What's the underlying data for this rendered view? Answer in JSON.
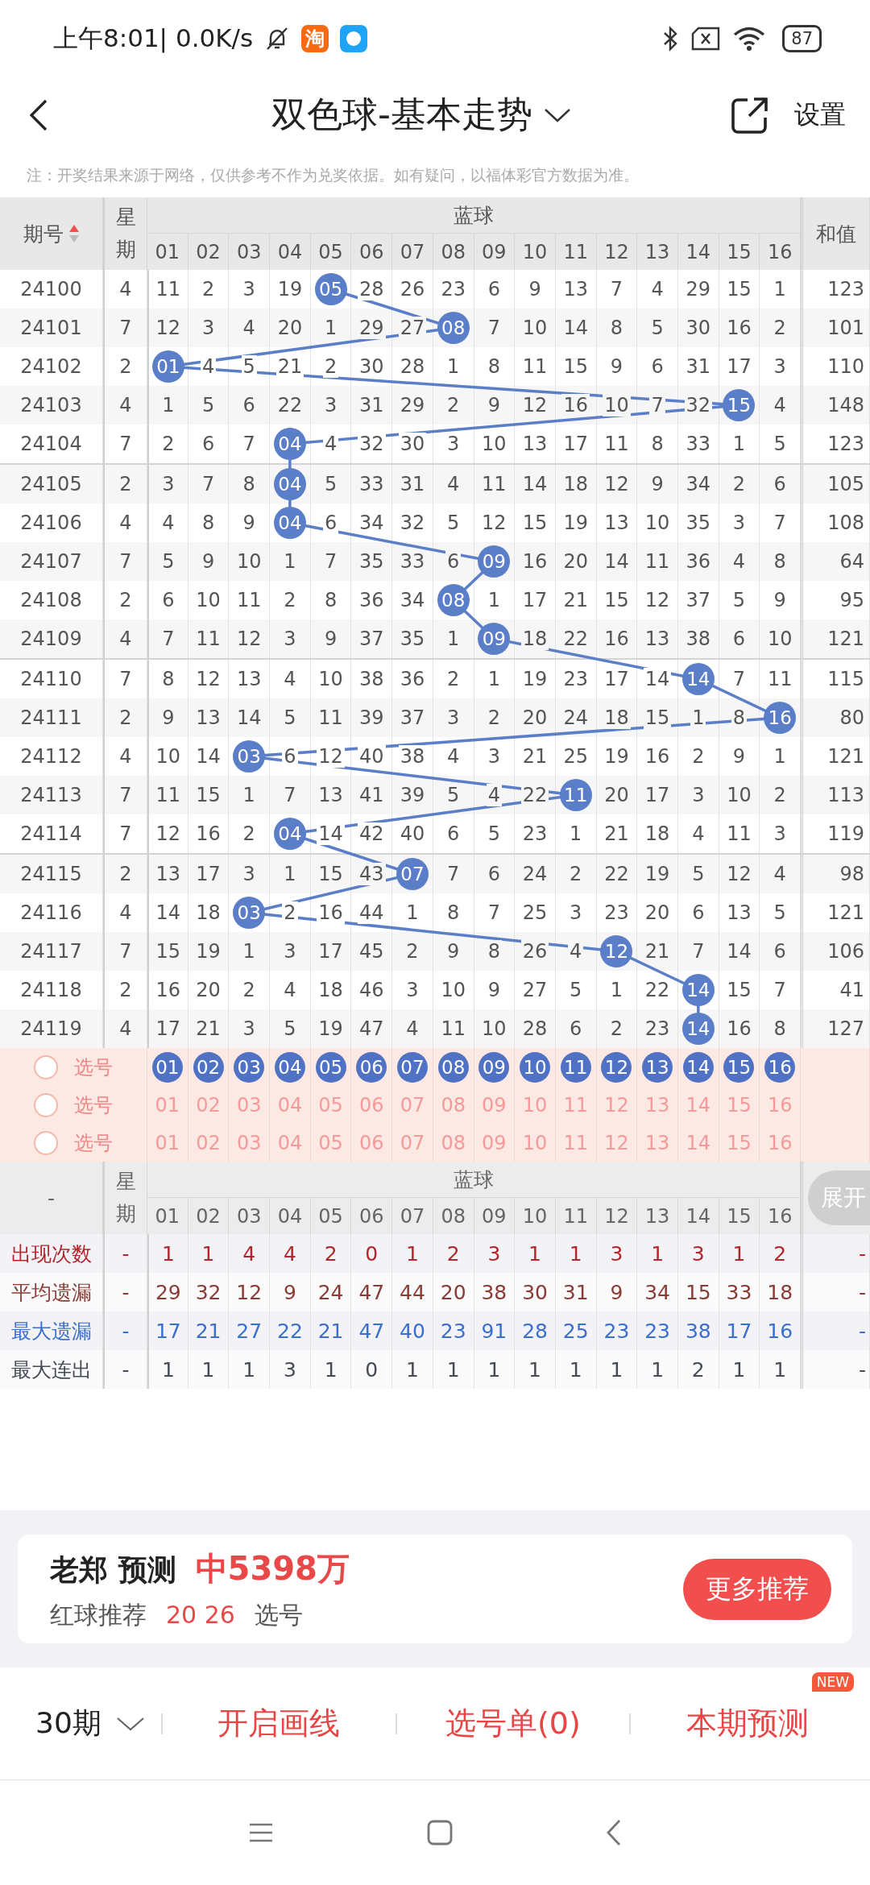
{
  "status_bar": {
    "time": "上午8:01| 0.0K/s",
    "app_glyph": "淘",
    "battery": "87"
  },
  "header": {
    "title": "双色球-基本走势",
    "settings": "设置"
  },
  "notice": "注：开奖结果来源于网络，仅供参考不作为兑奖依据。如有疑问，以福体彩官方数据为准。",
  "table": {
    "columns": {
      "period": "期号",
      "weekday": "星期",
      "group": "蓝球",
      "balls": [
        "01",
        "02",
        "03",
        "04",
        "05",
        "06",
        "07",
        "08",
        "09",
        "10",
        "11",
        "12",
        "13",
        "14",
        "15",
        "16"
      ],
      "sum": "和值"
    },
    "rows": [
      {
        "period": "24100",
        "weekday": "4",
        "sum": "123",
        "cells": [
          {
            "text": "11",
            "hit": false
          },
          {
            "text": "2",
            "hit": false
          },
          {
            "text": "3",
            "hit": false
          },
          {
            "text": "19",
            "hit": false
          },
          {
            "text": "05",
            "hit": true
          },
          {
            "text": "28",
            "hit": false
          },
          {
            "text": "26",
            "hit": false
          },
          {
            "text": "23",
            "hit": false
          },
          {
            "text": "6",
            "hit": false
          },
          {
            "text": "9",
            "hit": false
          },
          {
            "text": "13",
            "hit": false
          },
          {
            "text": "7",
            "hit": false
          },
          {
            "text": "4",
            "hit": false
          },
          {
            "text": "29",
            "hit": false
          },
          {
            "text": "15",
            "hit": false
          },
          {
            "text": "1",
            "hit": false
          }
        ]
      },
      {
        "period": "24101",
        "weekday": "7",
        "sum": "101",
        "cells": [
          {
            "text": "12",
            "hit": false
          },
          {
            "text": "3",
            "hit": false
          },
          {
            "text": "4",
            "hit": false
          },
          {
            "text": "20",
            "hit": false
          },
          {
            "text": "1",
            "hit": false
          },
          {
            "text": "29",
            "hit": false
          },
          {
            "text": "27",
            "hit": false
          },
          {
            "text": "08",
            "hit": true
          },
          {
            "text": "7",
            "hit": false
          },
          {
            "text": "10",
            "hit": false
          },
          {
            "text": "14",
            "hit": false
          },
          {
            "text": "8",
            "hit": false
          },
          {
            "text": "5",
            "hit": false
          },
          {
            "text": "30",
            "hit": false
          },
          {
            "text": "16",
            "hit": false
          },
          {
            "text": "2",
            "hit": false
          }
        ]
      },
      {
        "period": "24102",
        "weekday": "2",
        "sum": "110",
        "cells": [
          {
            "text": "01",
            "hit": true
          },
          {
            "text": "4",
            "hit": false
          },
          {
            "text": "5",
            "hit": false
          },
          {
            "text": "21",
            "hit": false
          },
          {
            "text": "2",
            "hit": false
          },
          {
            "text": "30",
            "hit": false
          },
          {
            "text": "28",
            "hit": false
          },
          {
            "text": "1",
            "hit": false
          },
          {
            "text": "8",
            "hit": false
          },
          {
            "text": "11",
            "hit": false
          },
          {
            "text": "15",
            "hit": false
          },
          {
            "text": "9",
            "hit": false
          },
          {
            "text": "6",
            "hit": false
          },
          {
            "text": "31",
            "hit": false
          },
          {
            "text": "17",
            "hit": false
          },
          {
            "text": "3",
            "hit": false
          }
        ]
      },
      {
        "period": "24103",
        "weekday": "4",
        "sum": "148",
        "cells": [
          {
            "text": "1",
            "hit": false
          },
          {
            "text": "5",
            "hit": false
          },
          {
            "text": "6",
            "hit": false
          },
          {
            "text": "22",
            "hit": false
          },
          {
            "text": "3",
            "hit": false
          },
          {
            "text": "31",
            "hit": false
          },
          {
            "text": "29",
            "hit": false
          },
          {
            "text": "2",
            "hit": false
          },
          {
            "text": "9",
            "hit": false
          },
          {
            "text": "12",
            "hit": false
          },
          {
            "text": "16",
            "hit": false
          },
          {
            "text": "10",
            "hit": false
          },
          {
            "text": "7",
            "hit": false
          },
          {
            "text": "32",
            "hit": false
          },
          {
            "text": "15",
            "hit": true
          },
          {
            "text": "4",
            "hit": false
          }
        ]
      },
      {
        "period": "24104",
        "weekday": "7",
        "sum": "123",
        "cells": [
          {
            "text": "2",
            "hit": false
          },
          {
            "text": "6",
            "hit": false
          },
          {
            "text": "7",
            "hit": false
          },
          {
            "text": "04",
            "hit": true
          },
          {
            "text": "4",
            "hit": false
          },
          {
            "text": "32",
            "hit": false
          },
          {
            "text": "30",
            "hit": false
          },
          {
            "text": "3",
            "hit": false
          },
          {
            "text": "10",
            "hit": false
          },
          {
            "text": "13",
            "hit": false
          },
          {
            "text": "17",
            "hit": false
          },
          {
            "text": "11",
            "hit": false
          },
          {
            "text": "8",
            "hit": false
          },
          {
            "text": "33",
            "hit": false
          },
          {
            "text": "1",
            "hit": false
          },
          {
            "text": "5",
            "hit": false
          }
        ]
      },
      {
        "period": "24105",
        "weekday": "2",
        "sum": "105",
        "cells": [
          {
            "text": "3",
            "hit": false
          },
          {
            "text": "7",
            "hit": false
          },
          {
            "text": "8",
            "hit": false
          },
          {
            "text": "04",
            "hit": true
          },
          {
            "text": "5",
            "hit": false
          },
          {
            "text": "33",
            "hit": false
          },
          {
            "text": "31",
            "hit": false
          },
          {
            "text": "4",
            "hit": false
          },
          {
            "text": "11",
            "hit": false
          },
          {
            "text": "14",
            "hit": false
          },
          {
            "text": "18",
            "hit": false
          },
          {
            "text": "12",
            "hit": false
          },
          {
            "text": "9",
            "hit": false
          },
          {
            "text": "34",
            "hit": false
          },
          {
            "text": "2",
            "hit": false
          },
          {
            "text": "6",
            "hit": false
          }
        ]
      },
      {
        "period": "24106",
        "weekday": "4",
        "sum": "108",
        "cells": [
          {
            "text": "4",
            "hit": false
          },
          {
            "text": "8",
            "hit": false
          },
          {
            "text": "9",
            "hit": false
          },
          {
            "text": "04",
            "hit": true
          },
          {
            "text": "6",
            "hit": false
          },
          {
            "text": "34",
            "hit": false
          },
          {
            "text": "32",
            "hit": false
          },
          {
            "text": "5",
            "hit": false
          },
          {
            "text": "12",
            "hit": false
          },
          {
            "text": "15",
            "hit": false
          },
          {
            "text": "19",
            "hit": false
          },
          {
            "text": "13",
            "hit": false
          },
          {
            "text": "10",
            "hit": false
          },
          {
            "text": "35",
            "hit": false
          },
          {
            "text": "3",
            "hit": false
          },
          {
            "text": "7",
            "hit": false
          }
        ]
      },
      {
        "period": "24107",
        "weekday": "7",
        "sum": "64",
        "cells": [
          {
            "text": "5",
            "hit": false
          },
          {
            "text": "9",
            "hit": false
          },
          {
            "text": "10",
            "hit": false
          },
          {
            "text": "1",
            "hit": false
          },
          {
            "text": "7",
            "hit": false
          },
          {
            "text": "35",
            "hit": false
          },
          {
            "text": "33",
            "hit": false
          },
          {
            "text": "6",
            "hit": false
          },
          {
            "text": "09",
            "hit": true
          },
          {
            "text": "16",
            "hit": false
          },
          {
            "text": "20",
            "hit": false
          },
          {
            "text": "14",
            "hit": false
          },
          {
            "text": "11",
            "hit": false
          },
          {
            "text": "36",
            "hit": false
          },
          {
            "text": "4",
            "hit": false
          },
          {
            "text": "8",
            "hit": false
          }
        ]
      },
      {
        "period": "24108",
        "weekday": "2",
        "sum": "95",
        "cells": [
          {
            "text": "6",
            "hit": false
          },
          {
            "text": "10",
            "hit": false
          },
          {
            "text": "11",
            "hit": false
          },
          {
            "text": "2",
            "hit": false
          },
          {
            "text": "8",
            "hit": false
          },
          {
            "text": "36",
            "hit": false
          },
          {
            "text": "34",
            "hit": false
          },
          {
            "text": "08",
            "hit": true
          },
          {
            "text": "1",
            "hit": false
          },
          {
            "text": "17",
            "hit": false
          },
          {
            "text": "21",
            "hit": false
          },
          {
            "text": "15",
            "hit": false
          },
          {
            "text": "12",
            "hit": false
          },
          {
            "text": "37",
            "hit": false
          },
          {
            "text": "5",
            "hit": false
          },
          {
            "text": "9",
            "hit": false
          }
        ]
      },
      {
        "period": "24109",
        "weekday": "4",
        "sum": "121",
        "cells": [
          {
            "text": "7",
            "hit": false
          },
          {
            "text": "11",
            "hit": false
          },
          {
            "text": "12",
            "hit": false
          },
          {
            "text": "3",
            "hit": false
          },
          {
            "text": "9",
            "hit": false
          },
          {
            "text": "37",
            "hit": false
          },
          {
            "text": "35",
            "hit": false
          },
          {
            "text": "1",
            "hit": false
          },
          {
            "text": "09",
            "hit": true
          },
          {
            "text": "18",
            "hit": false
          },
          {
            "text": "22",
            "hit": false
          },
          {
            "text": "16",
            "hit": false
          },
          {
            "text": "13",
            "hit": false
          },
          {
            "text": "38",
            "hit": false
          },
          {
            "text": "6",
            "hit": false
          },
          {
            "text": "10",
            "hit": false
          }
        ]
      },
      {
        "period": "24110",
        "weekday": "7",
        "sum": "115",
        "cells": [
          {
            "text": "8",
            "hit": false
          },
          {
            "text": "12",
            "hit": false
          },
          {
            "text": "13",
            "hit": false
          },
          {
            "text": "4",
            "hit": false
          },
          {
            "text": "10",
            "hit": false
          },
          {
            "text": "38",
            "hit": false
          },
          {
            "text": "36",
            "hit": false
          },
          {
            "text": "2",
            "hit": false
          },
          {
            "text": "1",
            "hit": false
          },
          {
            "text": "19",
            "hit": false
          },
          {
            "text": "23",
            "hit": false
          },
          {
            "text": "17",
            "hit": false
          },
          {
            "text": "14",
            "hit": false
          },
          {
            "text": "14",
            "hit": true
          },
          {
            "text": "7",
            "hit": false
          },
          {
            "text": "11",
            "hit": false
          }
        ]
      },
      {
        "period": "24111",
        "weekday": "2",
        "sum": "80",
        "cells": [
          {
            "text": "9",
            "hit": false
          },
          {
            "text": "13",
            "hit": false
          },
          {
            "text": "14",
            "hit": false
          },
          {
            "text": "5",
            "hit": false
          },
          {
            "text": "11",
            "hit": false
          },
          {
            "text": "39",
            "hit": false
          },
          {
            "text": "37",
            "hit": false
          },
          {
            "text": "3",
            "hit": false
          },
          {
            "text": "2",
            "hit": false
          },
          {
            "text": "20",
            "hit": false
          },
          {
            "text": "24",
            "hit": false
          },
          {
            "text": "18",
            "hit": false
          },
          {
            "text": "15",
            "hit": false
          },
          {
            "text": "1",
            "hit": false
          },
          {
            "text": "8",
            "hit": false
          },
          {
            "text": "16",
            "hit": true
          }
        ]
      },
      {
        "period": "24112",
        "weekday": "4",
        "sum": "121",
        "cells": [
          {
            "text": "10",
            "hit": false
          },
          {
            "text": "14",
            "hit": false
          },
          {
            "text": "03",
            "hit": true
          },
          {
            "text": "6",
            "hit": false
          },
          {
            "text": "12",
            "hit": false
          },
          {
            "text": "40",
            "hit": false
          },
          {
            "text": "38",
            "hit": false
          },
          {
            "text": "4",
            "hit": false
          },
          {
            "text": "3",
            "hit": false
          },
          {
            "text": "21",
            "hit": false
          },
          {
            "text": "25",
            "hit": false
          },
          {
            "text": "19",
            "hit": false
          },
          {
            "text": "16",
            "hit": false
          },
          {
            "text": "2",
            "hit": false
          },
          {
            "text": "9",
            "hit": false
          },
          {
            "text": "1",
            "hit": false
          }
        ]
      },
      {
        "period": "24113",
        "weekday": "7",
        "sum": "113",
        "cells": [
          {
            "text": "11",
            "hit": false
          },
          {
            "text": "15",
            "hit": false
          },
          {
            "text": "1",
            "hit": false
          },
          {
            "text": "7",
            "hit": false
          },
          {
            "text": "13",
            "hit": false
          },
          {
            "text": "41",
            "hit": false
          },
          {
            "text": "39",
            "hit": false
          },
          {
            "text": "5",
            "hit": false
          },
          {
            "text": "4",
            "hit": false
          },
          {
            "text": "22",
            "hit": false
          },
          {
            "text": "11",
            "hit": true
          },
          {
            "text": "20",
            "hit": false
          },
          {
            "text": "17",
            "hit": false
          },
          {
            "text": "3",
            "hit": false
          },
          {
            "text": "10",
            "hit": false
          },
          {
            "text": "2",
            "hit": false
          }
        ]
      },
      {
        "period": "24114",
        "weekday": "7",
        "sum": "119",
        "cells": [
          {
            "text": "12",
            "hit": false
          },
          {
            "text": "16",
            "hit": false
          },
          {
            "text": "2",
            "hit": false
          },
          {
            "text": "04",
            "hit": true
          },
          {
            "text": "14",
            "hit": false
          },
          {
            "text": "42",
            "hit": false
          },
          {
            "text": "40",
            "hit": false
          },
          {
            "text": "6",
            "hit": false
          },
          {
            "text": "5",
            "hit": false
          },
          {
            "text": "23",
            "hit": false
          },
          {
            "text": "1",
            "hit": false
          },
          {
            "text": "21",
            "hit": false
          },
          {
            "text": "18",
            "hit": false
          },
          {
            "text": "4",
            "hit": false
          },
          {
            "text": "11",
            "hit": false
          },
          {
            "text": "3",
            "hit": false
          }
        ]
      },
      {
        "period": "24115",
        "weekday": "2",
        "sum": "98",
        "cells": [
          {
            "text": "13",
            "hit": false
          },
          {
            "text": "17",
            "hit": false
          },
          {
            "text": "3",
            "hit": false
          },
          {
            "text": "1",
            "hit": false
          },
          {
            "text": "15",
            "hit": false
          },
          {
            "text": "43",
            "hit": false
          },
          {
            "text": "07",
            "hit": true
          },
          {
            "text": "7",
            "hit": false
          },
          {
            "text": "6",
            "hit": false
          },
          {
            "text": "24",
            "hit": false
          },
          {
            "text": "2",
            "hit": false
          },
          {
            "text": "22",
            "hit": false
          },
          {
            "text": "19",
            "hit": false
          },
          {
            "text": "5",
            "hit": false
          },
          {
            "text": "12",
            "hit": false
          },
          {
            "text": "4",
            "hit": false
          }
        ]
      },
      {
        "period": "24116",
        "weekday": "4",
        "sum": "121",
        "cells": [
          {
            "text": "14",
            "hit": false
          },
          {
            "text": "18",
            "hit": false
          },
          {
            "text": "03",
            "hit": true
          },
          {
            "text": "2",
            "hit": false
          },
          {
            "text": "16",
            "hit": false
          },
          {
            "text": "44",
            "hit": false
          },
          {
            "text": "1",
            "hit": false
          },
          {
            "text": "8",
            "hit": false
          },
          {
            "text": "7",
            "hit": false
          },
          {
            "text": "25",
            "hit": false
          },
          {
            "text": "3",
            "hit": false
          },
          {
            "text": "23",
            "hit": false
          },
          {
            "text": "20",
            "hit": false
          },
          {
            "text": "6",
            "hit": false
          },
          {
            "text": "13",
            "hit": false
          },
          {
            "text": "5",
            "hit": false
          }
        ]
      },
      {
        "period": "24117",
        "weekday": "7",
        "sum": "106",
        "cells": [
          {
            "text": "15",
            "hit": false
          },
          {
            "text": "19",
            "hit": false
          },
          {
            "text": "1",
            "hit": false
          },
          {
            "text": "3",
            "hit": false
          },
          {
            "text": "17",
            "hit": false
          },
          {
            "text": "45",
            "hit": false
          },
          {
            "text": "2",
            "hit": false
          },
          {
            "text": "9",
            "hit": false
          },
          {
            "text": "8",
            "hit": false
          },
          {
            "text": "26",
            "hit": false
          },
          {
            "text": "4",
            "hit": false
          },
          {
            "text": "12",
            "hit": true
          },
          {
            "text": "21",
            "hit": false
          },
          {
            "text": "7",
            "hit": false
          },
          {
            "text": "14",
            "hit": false
          },
          {
            "text": "6",
            "hit": false
          }
        ]
      },
      {
        "period": "24118",
        "weekday": "2",
        "sum": "41",
        "cells": [
          {
            "text": "16",
            "hit": false
          },
          {
            "text": "20",
            "hit": false
          },
          {
            "text": "2",
            "hit": false
          },
          {
            "text": "4",
            "hit": false
          },
          {
            "text": "18",
            "hit": false
          },
          {
            "text": "46",
            "hit": false
          },
          {
            "text": "3",
            "hit": false
          },
          {
            "text": "10",
            "hit": false
          },
          {
            "text": "9",
            "hit": false
          },
          {
            "text": "27",
            "hit": false
          },
          {
            "text": "5",
            "hit": false
          },
          {
            "text": "1",
            "hit": false
          },
          {
            "text": "22",
            "hit": false
          },
          {
            "text": "14",
            "hit": true
          },
          {
            "text": "15",
            "hit": false
          },
          {
            "text": "7",
            "hit": false
          }
        ]
      },
      {
        "period": "24119",
        "weekday": "4",
        "sum": "127",
        "cells": [
          {
            "text": "17",
            "hit": false
          },
          {
            "text": "21",
            "hit": false
          },
          {
            "text": "3",
            "hit": false
          },
          {
            "text": "5",
            "hit": false
          },
          {
            "text": "19",
            "hit": false
          },
          {
            "text": "47",
            "hit": false
          },
          {
            "text": "4",
            "hit": false
          },
          {
            "text": "11",
            "hit": false
          },
          {
            "text": "10",
            "hit": false
          },
          {
            "text": "28",
            "hit": false
          },
          {
            "text": "6",
            "hit": false
          },
          {
            "text": "2",
            "hit": false
          },
          {
            "text": "23",
            "hit": false
          },
          {
            "text": "14",
            "hit": true
          },
          {
            "text": "16",
            "hit": false
          },
          {
            "text": "8",
            "hit": false
          }
        ]
      }
    ],
    "pick_rows": [
      {
        "label": "选号",
        "checked": false,
        "numbers": [
          {
            "text": "01",
            "selected": true
          },
          {
            "text": "02",
            "selected": true
          },
          {
            "text": "03",
            "selected": true
          },
          {
            "text": "04",
            "selected": true
          },
          {
            "text": "05",
            "selected": true
          },
          {
            "text": "06",
            "selected": true
          },
          {
            "text": "07",
            "selected": true
          },
          {
            "text": "08",
            "selected": true
          },
          {
            "text": "09",
            "selected": true
          },
          {
            "text": "10",
            "selected": true
          },
          {
            "text": "11",
            "selected": true
          },
          {
            "text": "12",
            "selected": true
          },
          {
            "text": "13",
            "selected": true
          },
          {
            "text": "14",
            "selected": true
          },
          {
            "text": "15",
            "selected": true
          },
          {
            "text": "16",
            "selected": true
          }
        ]
      },
      {
        "label": "选号",
        "checked": false,
        "numbers": [
          {
            "text": "01",
            "selected": false
          },
          {
            "text": "02",
            "selected": false
          },
          {
            "text": "03",
            "selected": false
          },
          {
            "text": "04",
            "selected": false
          },
          {
            "text": "05",
            "selected": false
          },
          {
            "text": "06",
            "selected": false
          },
          {
            "text": "07",
            "selected": false
          },
          {
            "text": "08",
            "selected": false
          },
          {
            "text": "09",
            "selected": false
          },
          {
            "text": "10",
            "selected": false
          },
          {
            "text": "11",
            "selected": false
          },
          {
            "text": "12",
            "selected": false
          },
          {
            "text": "13",
            "selected": false
          },
          {
            "text": "14",
            "selected": false
          },
          {
            "text": "15",
            "selected": false
          },
          {
            "text": "16",
            "selected": false
          }
        ]
      },
      {
        "label": "选号",
        "checked": false,
        "numbers": [
          {
            "text": "01",
            "selected": false
          },
          {
            "text": "02",
            "selected": false
          },
          {
            "text": "03",
            "selected": false
          },
          {
            "text": "04",
            "selected": false
          },
          {
            "text": "05",
            "selected": false
          },
          {
            "text": "06",
            "selected": false
          },
          {
            "text": "07",
            "selected": false
          },
          {
            "text": "08",
            "selected": false
          },
          {
            "text": "09",
            "selected": false
          },
          {
            "text": "10",
            "selected": false
          },
          {
            "text": "11",
            "selected": false
          },
          {
            "text": "12",
            "selected": false
          },
          {
            "text": "13",
            "selected": false
          },
          {
            "text": "14",
            "selected": false
          },
          {
            "text": "15",
            "selected": false
          },
          {
            "text": "16",
            "selected": false
          }
        ]
      }
    ]
  },
  "stats": {
    "header": {
      "label": "-",
      "weekday": "星期",
      "group": "蓝球",
      "balls": [
        "01",
        "02",
        "03",
        "04",
        "05",
        "06",
        "07",
        "08",
        "09",
        "10",
        "11",
        "12",
        "13",
        "14",
        "15",
        "16"
      ],
      "expand": "展开"
    },
    "rows": [
      {
        "label": "出现次数",
        "color": "#b3262b",
        "weekday": "-",
        "sum": "-",
        "values": [
          "1",
          "1",
          "4",
          "4",
          "2",
          "0",
          "1",
          "2",
          "3",
          "1",
          "1",
          "3",
          "1",
          "3",
          "1",
          "2"
        ]
      },
      {
        "label": "平均遗漏",
        "color": "#8a3b36",
        "weekday": "-",
        "sum": "-",
        "values": [
          "29",
          "32",
          "12",
          "9",
          "24",
          "47",
          "44",
          "20",
          "38",
          "30",
          "31",
          "9",
          "34",
          "15",
          "33",
          "18"
        ]
      },
      {
        "label": "最大遗漏",
        "color": "#3a6fd0",
        "weekday": "-",
        "sum": "-",
        "values": [
          "17",
          "21",
          "27",
          "22",
          "21",
          "47",
          "40",
          "23",
          "91",
          "28",
          "25",
          "23",
          "23",
          "38",
          "17",
          "16"
        ]
      },
      {
        "label": "最大连出",
        "color": "#454a55",
        "weekday": "-",
        "sum": "-",
        "values": [
          "1",
          "1",
          "1",
          "3",
          "1",
          "0",
          "1",
          "1",
          "1",
          "1",
          "1",
          "1",
          "1",
          "2",
          "1",
          "1"
        ]
      }
    ]
  },
  "promo": {
    "title": "老郑 预测",
    "highlight": "中5398万",
    "label": "红球推荐",
    "numbers": "20 26",
    "pick": "选号",
    "button": "更多推荐"
  },
  "toolbar": {
    "periods": "30期",
    "draw": "开启画线",
    "list": "选号单(0)",
    "predict": "本期预测",
    "badge": "NEW"
  }
}
